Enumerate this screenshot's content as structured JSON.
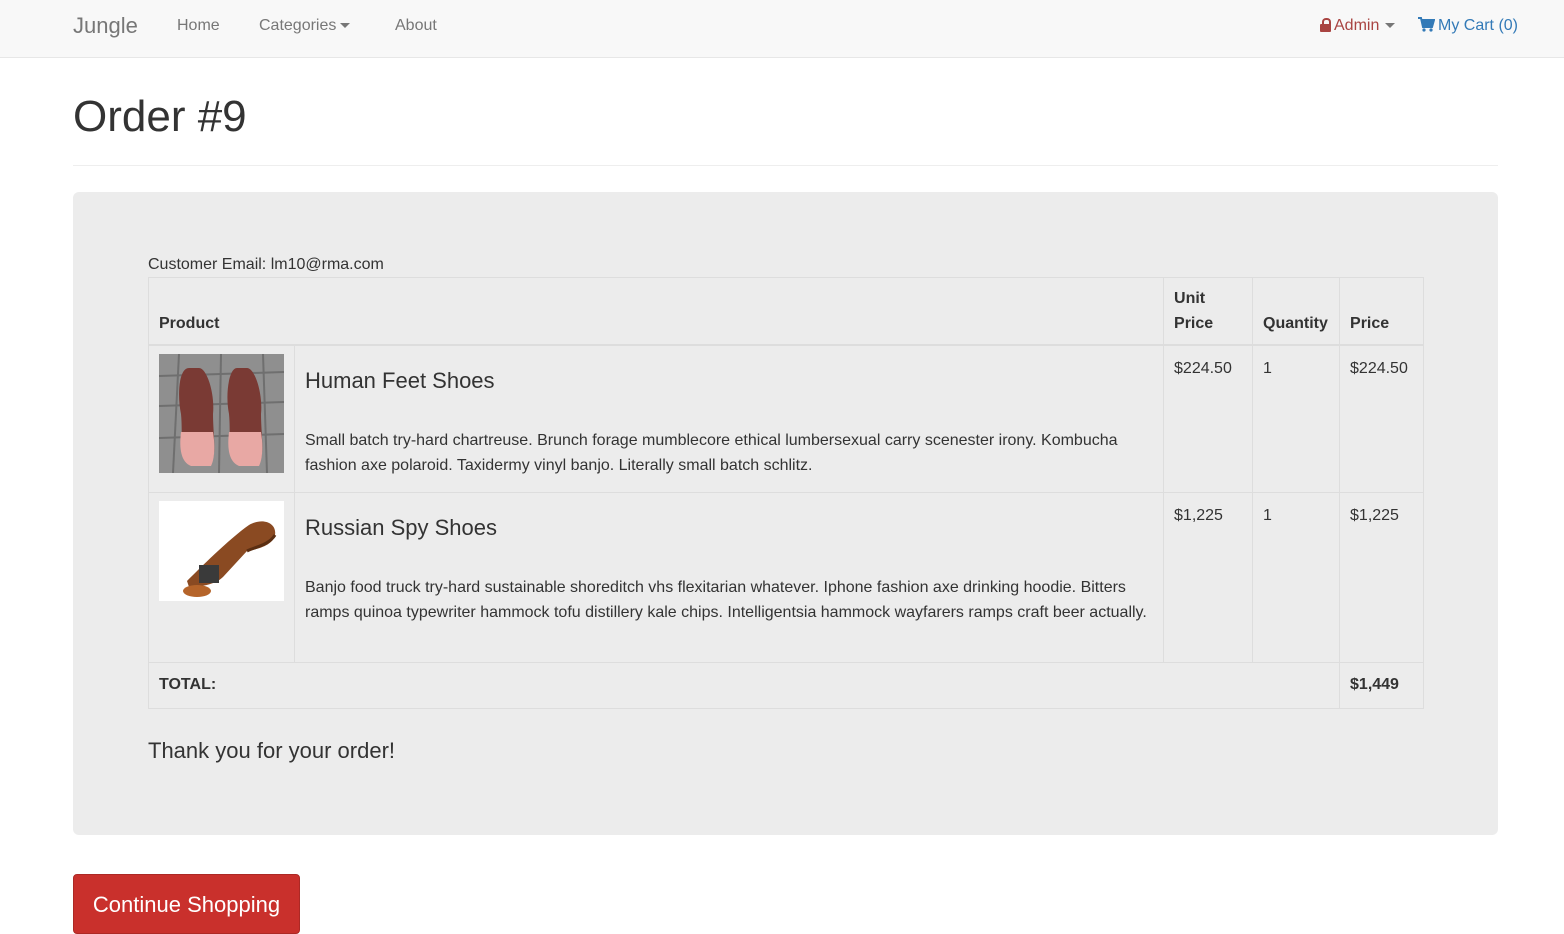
{
  "navbar": {
    "brand": "Jungle",
    "links": [
      "Home",
      "Categories",
      "About"
    ],
    "admin_label": "Admin",
    "cart_label": "My Cart (0)"
  },
  "page": {
    "title": "Order #9"
  },
  "order": {
    "customer_email_label": "Customer Email:",
    "customer_email": "lm10@rma.com",
    "headers": {
      "product": "Product",
      "unit_price_line1": "Unit",
      "unit_price_line2": "Price",
      "quantity": "Quantity",
      "price": "Price"
    },
    "items": [
      {
        "name": "Human Feet Shoes",
        "description": "Small batch try-hard chartreuse. Brunch forage mumblecore ethical lumbersexual carry scenester irony. Kombucha fashion axe polaroid. Taxidermy vinyl banjo. Literally small batch schlitz.",
        "unit_price": "$224.50",
        "quantity": "1",
        "price": "$224.50",
        "image_icon": "human-feet-shoes-image"
      },
      {
        "name": "Russian Spy Shoes",
        "description": "Banjo food truck try-hard sustainable shoreditch vhs flexitarian whatever. Iphone fashion axe drinking hoodie. Bitters ramps quinoa typewriter hammock tofu distillery kale chips. Intelligentsia hammock wayfarers ramps craft beer actually.",
        "unit_price": "$1,225",
        "quantity": "1",
        "price": "$1,225",
        "image_icon": "russian-spy-shoes-image"
      }
    ],
    "total_label": "TOTAL:",
    "total_value": "$1,449",
    "thank_you": "Thank you for your order!"
  },
  "actions": {
    "continue_label": "Continue Shopping"
  },
  "colors": {
    "navbar_bg": "#f8f8f8",
    "well_bg": "#ececec",
    "admin": "#a94442",
    "cart": "#337ab7",
    "button": "#c9302c"
  }
}
